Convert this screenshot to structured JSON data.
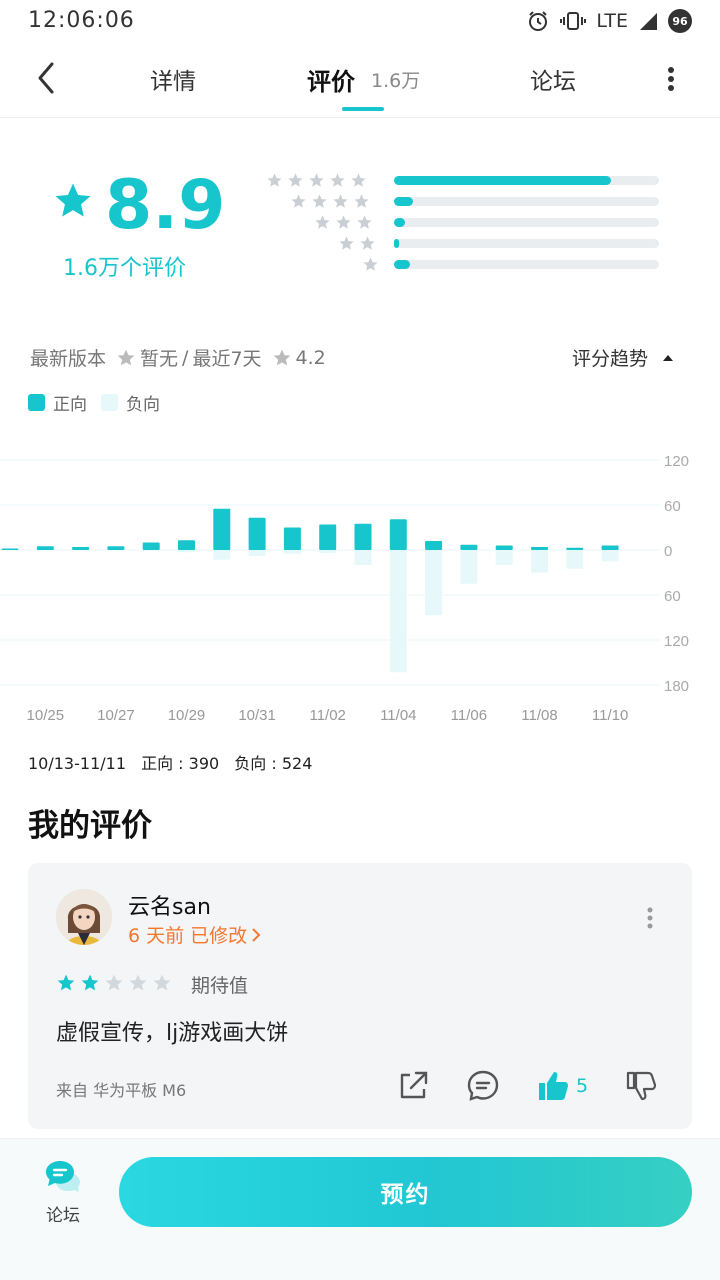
{
  "status_bar": {
    "time": "12:06:06",
    "network": "LTE",
    "badge": "96",
    "icons": [
      "alarm-icon",
      "vibrate-icon",
      "signal-icon"
    ]
  },
  "tabs": {
    "detail": "详情",
    "review": "评价",
    "review_count": "1.6万",
    "forum": "论坛"
  },
  "score": {
    "value": "8.9",
    "count": "1.6万个评价",
    "distribution": [
      {
        "stars": 5,
        "fraction": 0.82
      },
      {
        "stars": 4,
        "fraction": 0.07
      },
      {
        "stars": 3,
        "fraction": 0.04
      },
      {
        "stars": 2,
        "fraction": 0.02
      },
      {
        "stars": 1,
        "fraction": 0.06
      }
    ]
  },
  "version": {
    "latest_label": "最新版本",
    "latest_value": "暂无",
    "separator": "/",
    "recent_label": "最近7天",
    "recent_value": "4.2",
    "trend_label": "评分趋势"
  },
  "legend": {
    "positive": "正向",
    "negative": "负向"
  },
  "chart_data": {
    "type": "bar",
    "categories": [
      "10/24",
      "10/25",
      "10/26",
      "10/27",
      "10/28",
      "10/29",
      "10/30",
      "10/31",
      "11/01",
      "11/02",
      "11/03",
      "11/04",
      "11/05",
      "11/06",
      "11/07",
      "11/08",
      "11/09",
      "11/10",
      "11/11"
    ],
    "x_tick_labels": [
      "10/25",
      "10/27",
      "10/29",
      "10/31",
      "11/02",
      "11/04",
      "11/06",
      "11/08",
      "11/10"
    ],
    "series": [
      {
        "name": "正向",
        "values": [
          2,
          5,
          4,
          5,
          10,
          13,
          55,
          43,
          30,
          34,
          35,
          41,
          12,
          7,
          6,
          4,
          3,
          6,
          0
        ]
      },
      {
        "name": "负向",
        "values": [
          0,
          0,
          0,
          0,
          0,
          3,
          13,
          8,
          5,
          4,
          20,
          163,
          87,
          45,
          20,
          30,
          25,
          15,
          0
        ]
      }
    ],
    "y_tick_labels": [
      "120",
      "60",
      "0",
      "60",
      "120",
      "180"
    ],
    "ylim": [
      -180,
      120
    ],
    "grid": true,
    "colors": {
      "positive": "#17c5cd",
      "negative": "#e6f8fa"
    }
  },
  "summary": {
    "range": "10/13-11/11",
    "positive": "正向 : 390",
    "negative": "负向 : 524"
  },
  "my_review": {
    "section_title": "我的评价",
    "username": "云名san",
    "edited": "6 天前 已修改",
    "rating": 2,
    "tag": "期待值",
    "text": "虚假宣传，lj游戏画大饼",
    "device": "来自 华为平板 M6",
    "like_count": "5"
  },
  "bottom": {
    "forum_label": "论坛",
    "reserve_label": "预约"
  },
  "colors": {
    "accent": "#17c5cd",
    "edited": "#f5772f",
    "star_grey": "#c9cfd4"
  }
}
